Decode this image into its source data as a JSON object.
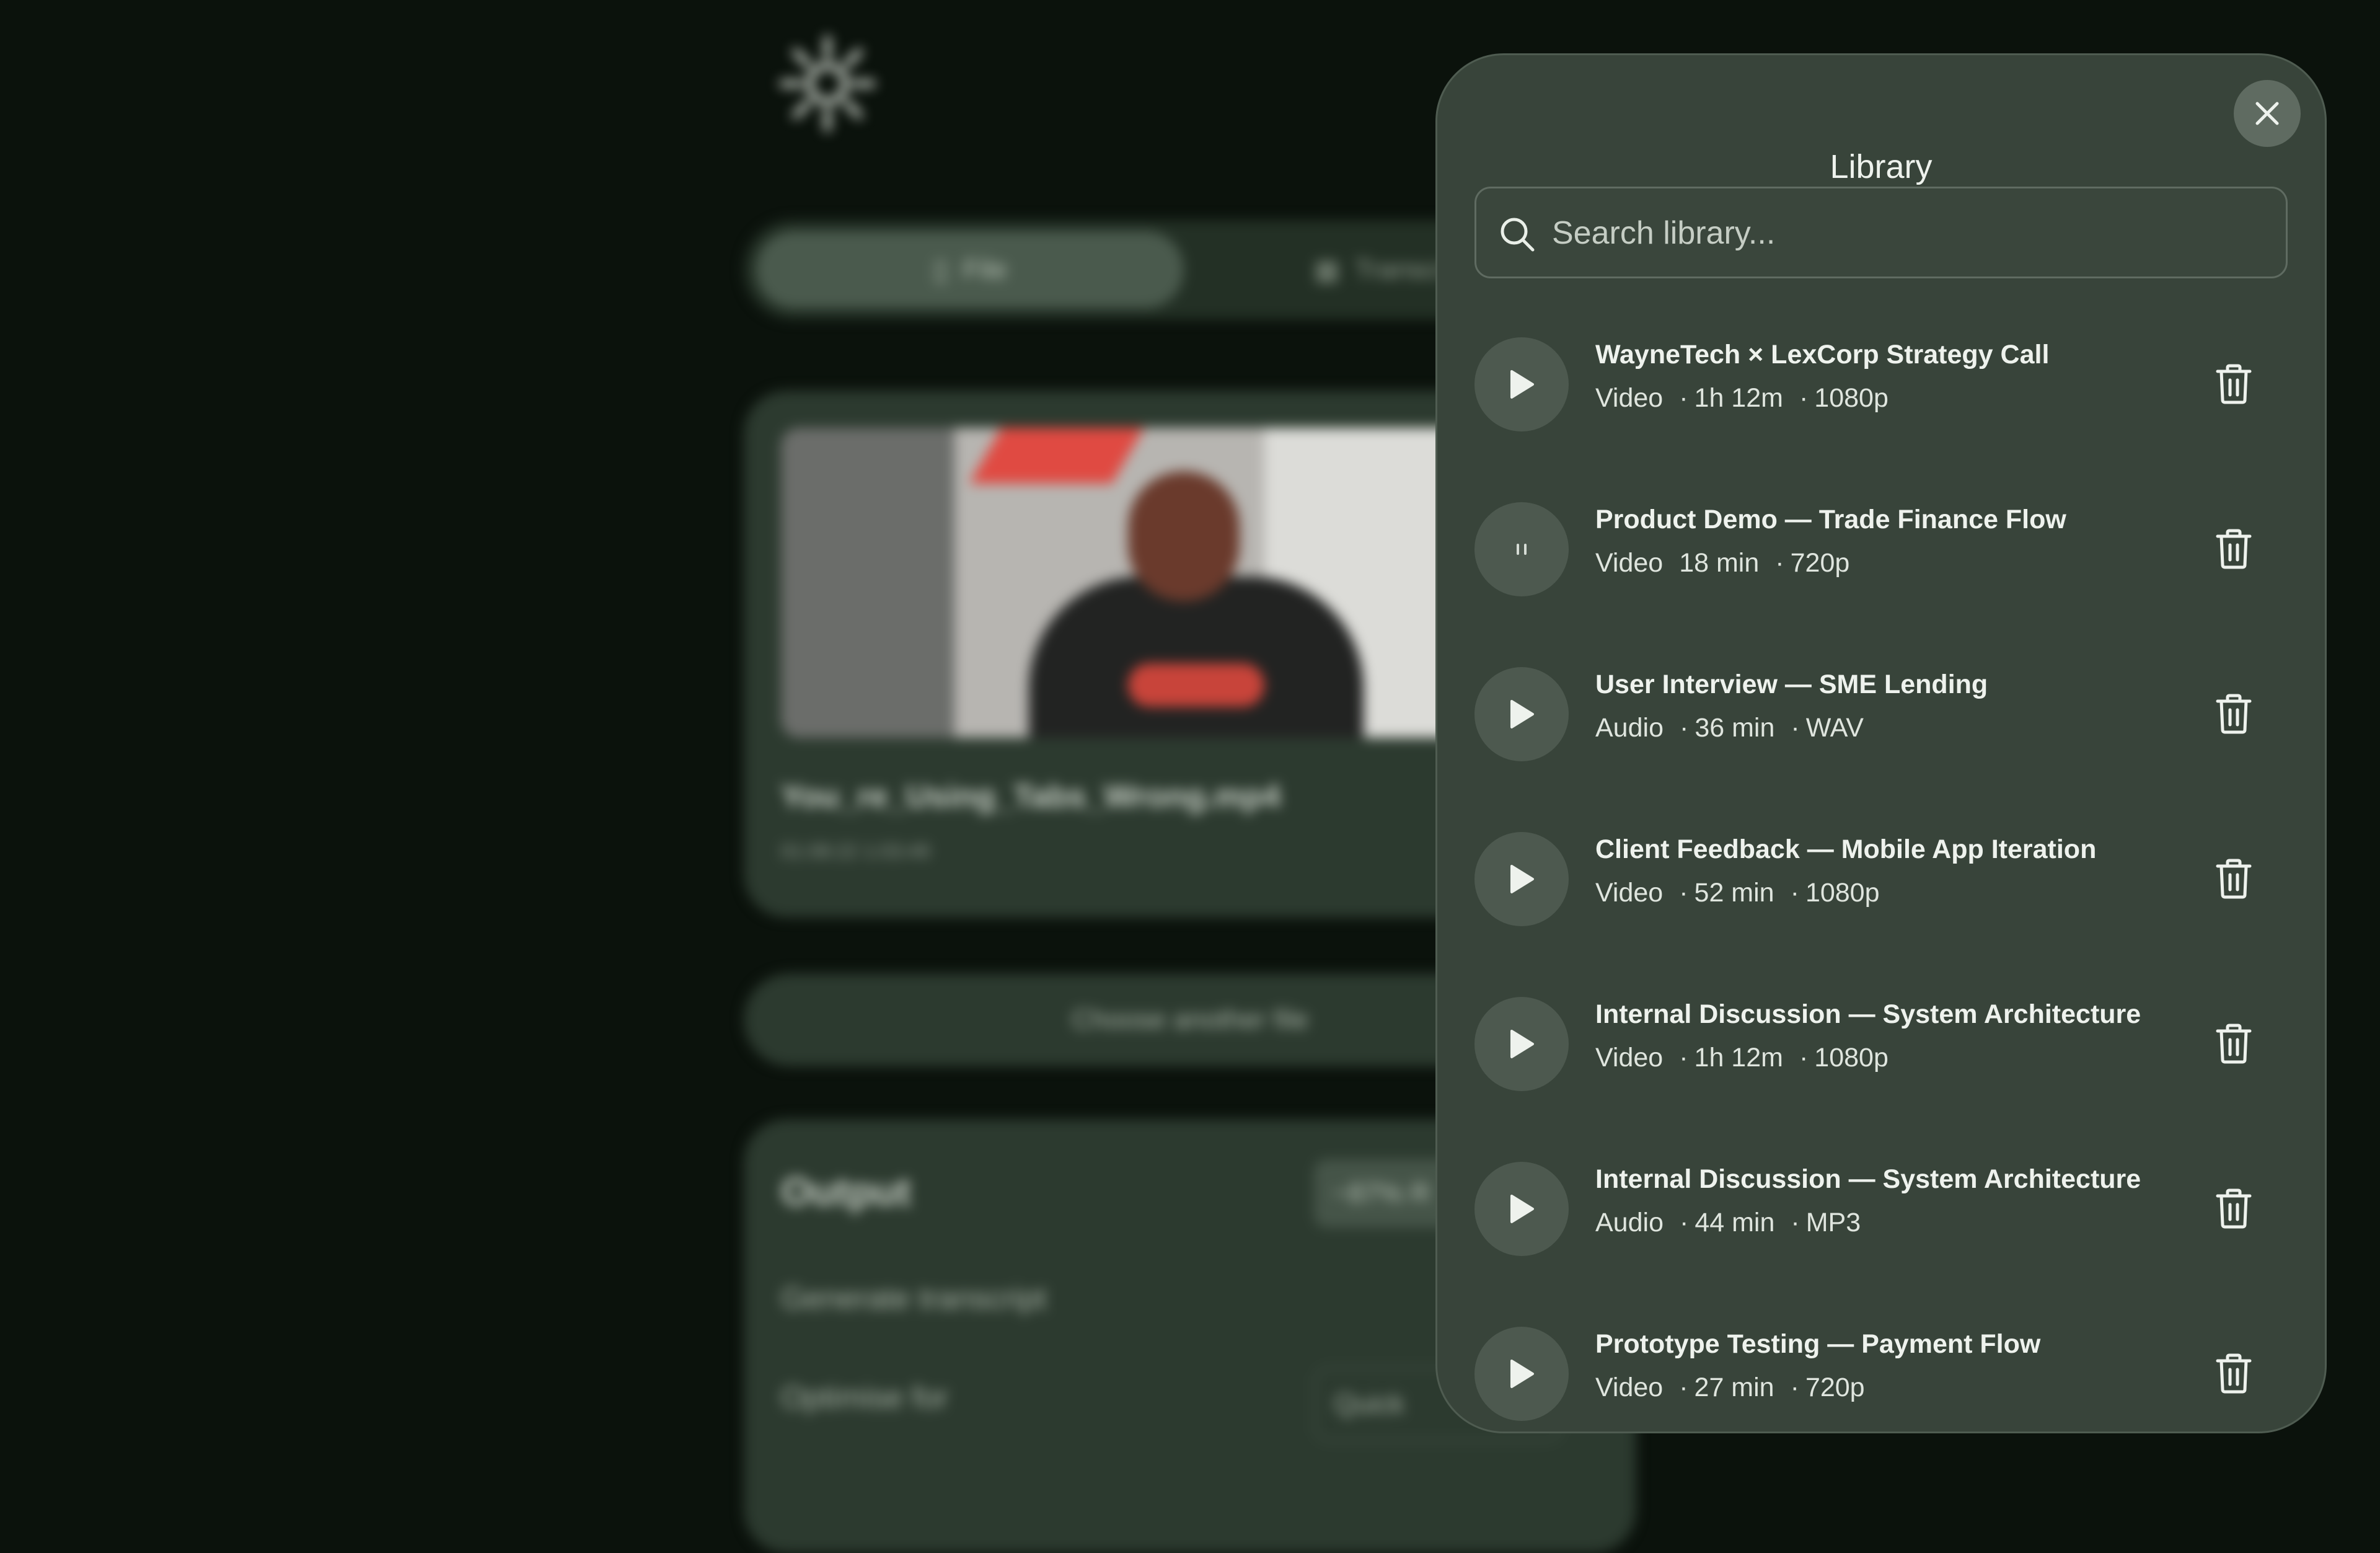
{
  "background": {
    "tabs": {
      "file_label": "File",
      "transcript_label": "Transcript"
    },
    "media": {
      "file_name": "You_re_Using_Tabs_Wrong.mp4",
      "file_meta": "01:08:22  1:03:49"
    },
    "choose_another": "Choose another file",
    "output": {
      "title": "Output",
      "badge": "~87% R",
      "generate_label": "Generate transcript",
      "optimise_label": "Optimise for",
      "optimise_value": "Quick"
    }
  },
  "library": {
    "title": "Library",
    "search": {
      "placeholder": "Search library...",
      "value": ""
    },
    "items": [
      {
        "title": "WayneTech × LexCorp Strategy Call",
        "type": "Video",
        "duration": "1h 12m",
        "quality": "1080p",
        "state": "play"
      },
      {
        "title": "Product Demo — Trade Finance Flow",
        "type": "Video",
        "duration": "18 min",
        "quality": "720p",
        "state": "pause"
      },
      {
        "title": "User Interview — SME Lending",
        "type": "Audio",
        "duration": "36 min",
        "quality": "WAV",
        "state": "play"
      },
      {
        "title": "Client Feedback — Mobile App Iteration",
        "type": "Video",
        "duration": "52 min",
        "quality": "1080p",
        "state": "play"
      },
      {
        "title": "Internal Discussion — System Architecture",
        "type": "Video",
        "duration": "1h 12m",
        "quality": "1080p",
        "state": "play"
      },
      {
        "title": "Internal Discussion — System Architecture",
        "type": "Audio",
        "duration": "44 min",
        "quality": "MP3",
        "state": "play"
      },
      {
        "title": "Prototype Testing — Payment Flow",
        "type": "Video",
        "duration": "27 min",
        "quality": "720p",
        "state": "play"
      }
    ]
  }
}
